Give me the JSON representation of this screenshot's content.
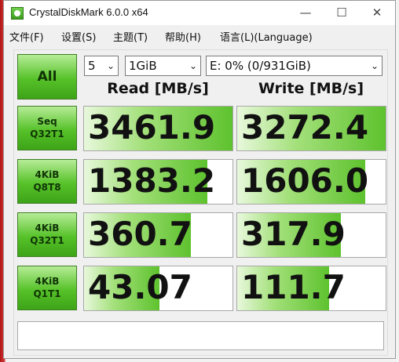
{
  "window": {
    "title": "CrystalDiskMark 6.0.0 x64",
    "minimize": "—",
    "maximize": "☐",
    "close": "✕"
  },
  "menu": [
    {
      "label": "文件(F)"
    },
    {
      "label": "设置(S)"
    },
    {
      "label": "主题(T)"
    },
    {
      "label": "帮助(H)"
    },
    {
      "label": "语言(L)(Language)"
    }
  ],
  "controls": {
    "all_label": "All",
    "count_value": "5",
    "size_value": "1GiB",
    "drive_value": "E: 0% (0/931GiB)",
    "dropdown_glyph": "⌄"
  },
  "headers": {
    "read": "Read [MB/s]",
    "write": "Write [MB/s]"
  },
  "tests": [
    {
      "line1": "Seq",
      "line2": "Q32T1",
      "read": "3461.9",
      "write": "3272.4",
      "read_level": 1.0,
      "write_level": 1.0
    },
    {
      "line1": "4KiB",
      "line2": "Q8T8",
      "read": "1383.2",
      "write": "1606.0",
      "read_level": 0.83,
      "write_level": 0.86
    },
    {
      "line1": "4KiB",
      "line2": "Q32T1",
      "read": "360.7",
      "write": "317.9",
      "read_level": 0.72,
      "write_level": 0.7
    },
    {
      "line1": "4KiB",
      "line2": "Q1T1",
      "read": "43.07",
      "write": "111.7",
      "read_level": 0.51,
      "write_level": 0.62
    }
  ],
  "colors": {
    "accent_green": "#56c229",
    "desktop_red": "#d83a3a"
  }
}
